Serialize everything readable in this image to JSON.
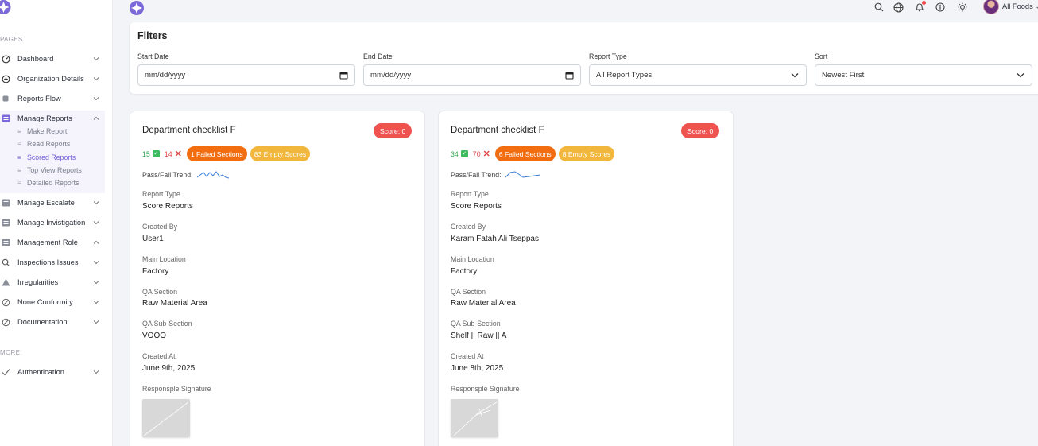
{
  "sidebar": {
    "section_pages": "PAGES",
    "section_more": "MORE",
    "items": [
      {
        "label": "Dashboard",
        "icon": "dashboard-icon"
      },
      {
        "label": "Organization Details",
        "icon": "plus-circle-icon"
      },
      {
        "label": "Reports Flow",
        "icon": "document-icon"
      },
      {
        "label": "Manage Reports",
        "icon": "reports-icon",
        "expanded": true
      },
      {
        "label": "Manage Escalate",
        "icon": "list-icon"
      },
      {
        "label": "Manage Invistigation",
        "icon": "list-icon"
      },
      {
        "label": "Management Role",
        "icon": "list-icon",
        "expanded": true
      },
      {
        "label": "Inspections Issues",
        "icon": "search-icon"
      },
      {
        "label": "Irregularities",
        "icon": "warning-icon"
      },
      {
        "label": "None Conformity",
        "icon": "ban-icon"
      },
      {
        "label": "Documentation",
        "icon": "ban-icon"
      },
      {
        "label": "Authentication",
        "icon": "check-icon"
      }
    ],
    "sub_items": [
      "Make Report",
      "Read Reports",
      "Scored Reports",
      "Top View Reports",
      "Detailed Reports"
    ],
    "active_sub": "Scored Reports"
  },
  "topbar": {
    "user_name": "All Foods",
    "icons": [
      "search-icon",
      "globe-icon",
      "notifications-icon",
      "info-icon",
      "theme-toggle-icon"
    ]
  },
  "filters": {
    "title": "Filters",
    "start_date": {
      "label": "Start Date",
      "value": "mm/dd/yyyy"
    },
    "end_date": {
      "label": "End Date",
      "value": "mm/dd/yyyy"
    },
    "report_type": {
      "label": "Report Type",
      "value": "All Report Types"
    },
    "sort": {
      "label": "Sort",
      "value": "Newest First"
    }
  },
  "labels": {
    "trend": "Pass/Fail Trend:",
    "report_type": "Report Type",
    "created_by": "Created By",
    "main_location": "Main Location",
    "qa_section": "QA Section",
    "qa_sub_section": "QA Sub-Section",
    "created_at": "Created At",
    "signature": "Responsple Signature"
  },
  "cards": [
    {
      "title": "Department checklist F",
      "score": "Score: 0",
      "passed": "15",
      "failed": "14",
      "failed_sections": "1 Failed Sections",
      "empty_scores": "83 Empty Scores",
      "report_type": "Score Reports",
      "created_by": "User1",
      "main_location": "Factory",
      "qa_section": "Raw Material Area",
      "qa_sub_section": "VOOO",
      "created_at": "June 9th, 2025"
    },
    {
      "title": "Department checklist F",
      "score": "Score: 0",
      "passed": "34",
      "failed": "70",
      "failed_sections": "6 Failed Sections",
      "empty_scores": "8 Empty Scores",
      "report_type": "Score Reports",
      "created_by": "Karam Fatah Ali Tseppas",
      "main_location": "Factory",
      "qa_section": "Raw Material Area",
      "qa_sub_section": "Shelf || Raw || A",
      "created_at": "June 8th, 2025"
    }
  ],
  "colors": {
    "accent": "#6f5fd6",
    "score_badge": "#ef5350",
    "failed_sections": "#f26c10",
    "empty_scores": "#f0b73c",
    "pass": "#3dbb5f",
    "fail": "#e04848"
  }
}
